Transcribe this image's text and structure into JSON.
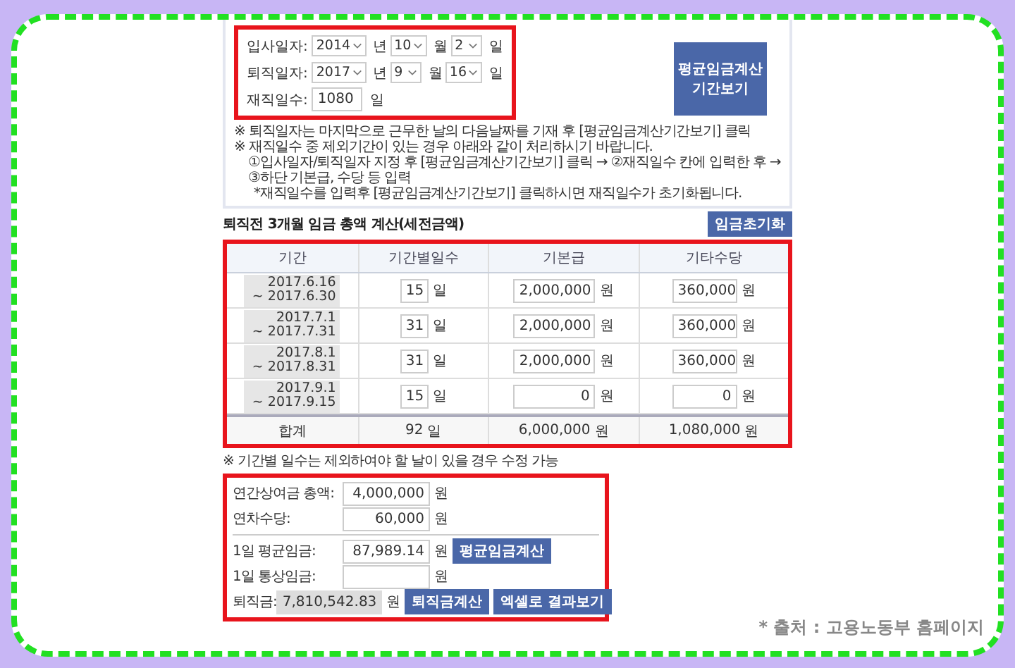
{
  "dates": {
    "rows": [
      {
        "label": "입사일자:",
        "year": "2014",
        "year_unit": "년",
        "month": "10",
        "month_unit": "월",
        "day": "2",
        "day_unit": "일"
      },
      {
        "label": "퇴직일자:",
        "year": "2017",
        "year_unit": "년",
        "month": "9",
        "month_unit": "월",
        "day": "16",
        "day_unit": "일"
      }
    ],
    "tenure": {
      "label": "재직일수:",
      "value": "1080",
      "unit": "일"
    }
  },
  "period_button": [
    "평균임금계산",
    "기간보기"
  ],
  "notes": [
    "※ 퇴직일자는 마지막으로 근무한 날의 다음날짜를 기재 후 [평균임금계산기간보기] 클릭",
    "※ 재직일수 중 제외기간이 있는 경우 아래와 같이 처리하시기 바랍니다."
  ],
  "steps": "①입사일자/퇴직일자 지정 후 [평균임금계산기간보기] 클릭 → ②재직일수 칸에 입력한 후 → ③하단 기본급, 수당 등 입력",
  "steps_note": "*재직일수를 입력후 [평균임금계산기간보기] 클릭하시면 재직일수가 초기화됩니다.",
  "section_title": "퇴직전 3개월 임금 총액 계산(세전금액)",
  "reset_button": "임금초기화",
  "table": {
    "columns": [
      "기간",
      "기간별일수",
      "기본급",
      "기타수당"
    ],
    "rows": [
      {
        "period": [
          "2017.6.16",
          "~ 2017.6.30"
        ],
        "days": "15",
        "days_unit": "일",
        "base": "2,000,000",
        "base_unit": "원",
        "other": "360,000",
        "other_unit": "원"
      },
      {
        "period": [
          "2017.7.1",
          "~ 2017.7.31"
        ],
        "days": "31",
        "days_unit": "일",
        "base": "2,000,000",
        "base_unit": "원",
        "other": "360,000",
        "other_unit": "원"
      },
      {
        "period": [
          "2017.8.1",
          "~ 2017.8.31"
        ],
        "days": "31",
        "days_unit": "일",
        "base": "2,000,000",
        "base_unit": "원",
        "other": "360,000",
        "other_unit": "원"
      },
      {
        "period": [
          "2017.9.1",
          "~ 2017.9.15"
        ],
        "days": "15",
        "days_unit": "일",
        "base": "0",
        "base_unit": "원",
        "other": "0",
        "other_unit": "원"
      }
    ],
    "total": {
      "label": "합계",
      "days": "92",
      "days_unit": "일",
      "base": "6,000,000",
      "base_unit": "원",
      "other": "1,080,000",
      "other_unit": "원"
    }
  },
  "table_note": "※ 기간별 일수는 제외하여야 할 날이 있을 경우 수정 가능",
  "extra_rows": [
    {
      "label": "연간상여금 총액:",
      "value": "4,000,000",
      "unit": "원"
    },
    {
      "label": "연차수당:",
      "value": "60,000",
      "unit": "원"
    }
  ],
  "result_rows": [
    {
      "kind": "field",
      "label": "1일 평균임금:",
      "value": "87,989.14",
      "unit": "원",
      "buttons": [
        "평균임금계산"
      ]
    },
    {
      "kind": "field",
      "label": "1일 통상임금:",
      "unit": "원"
    },
    {
      "kind": "readonly",
      "label": "퇴직금:",
      "value": "7,810,542.83",
      "unit": "원",
      "buttons": [
        "퇴직금계산",
        "엑셀로 결과보기"
      ]
    }
  ],
  "caption": "* 출처 : 고용노동부 홈페이지"
}
